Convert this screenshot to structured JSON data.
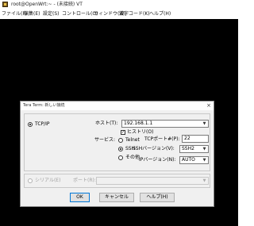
{
  "window": {
    "title": "root@OpenWrt:~ - (未接続) VT",
    "icon": "teraterm-icon"
  },
  "menu": [
    "ファイル(F)",
    "編集(E)",
    "設定(S)",
    "コントロール(O)",
    "ウィンドウ(W)",
    "漢字コード(K)",
    "ヘルプ(H)"
  ],
  "dialog": {
    "title": "Tera Term: 新しい接続",
    "close": "×",
    "tcpip_label": "TCP/IP",
    "host_label": "ホスト(T):",
    "host_value": "192.168.1.1",
    "history_label": "ヒストリ(O)",
    "service_label": "サービス:",
    "telnet_label": "Telnet",
    "ssh_label": "SSH",
    "other_label": "その他",
    "tcp_port_label": "TCPポート#(P):",
    "tcp_port_value": "22",
    "ssh_version_label": "SSHバージョン(V):",
    "ssh_version_value": "SSH2",
    "ip_version_label": "IPバージョン(N):",
    "ip_version_value": "AUTO",
    "serial_label": "シリアル(E)",
    "port_label": "ポート(R):",
    "port_value": "",
    "ok_label": "OK",
    "cancel_label": "キャンセル",
    "help_label": "ヘルプ(H)"
  },
  "colors": {
    "terminal_bg": "#000000",
    "dialog_bg": "#f0f0f0",
    "accent": "#0078d7"
  }
}
